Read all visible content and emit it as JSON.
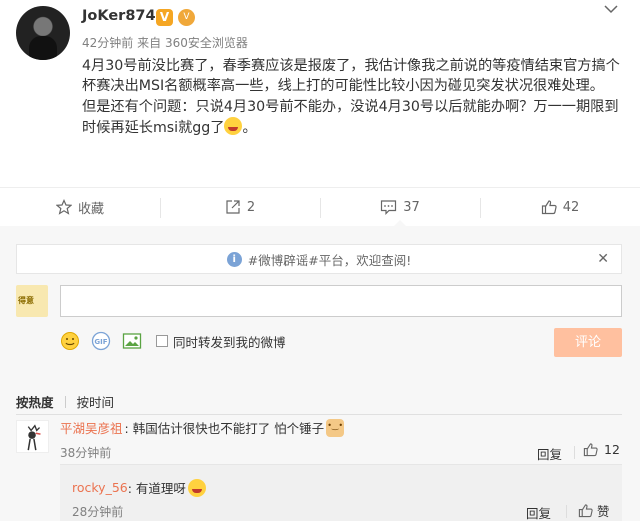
{
  "post": {
    "username": "JoKer874",
    "verified_badge": "V",
    "level_badge": "V",
    "time": "42分钟前",
    "source_prefix": "来自",
    "source": "360安全浏览器",
    "paragraph1": "4月30号前没比赛了，春季赛应该是报废了，我估计像我之前说的等疫情结束官方搞个杯赛决出MSI名额概率高一些，线上打的可能性比较小因为碰见突发状况很难处理。",
    "paragraph2": "但是还有个问题：只说4月30号前不能办，没说4月30号以后就能办啊？万一一期限到时候再延长msi就gg了",
    "paragraph2_end": "。",
    "emoji": "laughing-tears-emoji"
  },
  "actions": {
    "collect": "收藏",
    "repost": "2",
    "comment": "37",
    "like": "42"
  },
  "notice": {
    "text": "#微博辟谣#平台，欢迎查阅!"
  },
  "my_avatar_text": "得意",
  "comment_box": {
    "placeholder": "",
    "repost_label": "同时转发到我的微博",
    "submit": "评论"
  },
  "sort": {
    "active": "按热度",
    "inactive": "按时间"
  },
  "comments": [
    {
      "user": "平湖吴彦祖",
      "text": ": 韩国估计很快也不能打了 怕个锤子",
      "time": "38分钟前",
      "reply": "回复",
      "likes": "12",
      "sub": {
        "user": "rocky_56",
        "text": ": 有道理呀",
        "time": "28分钟前",
        "reply": "回复",
        "like": "赞"
      }
    }
  ],
  "colors": {
    "username_link": "#eb7350",
    "submit_disabled": "#ffc09f",
    "vip_gold": "#f5a623",
    "info_blue": "#7ba3d6"
  }
}
